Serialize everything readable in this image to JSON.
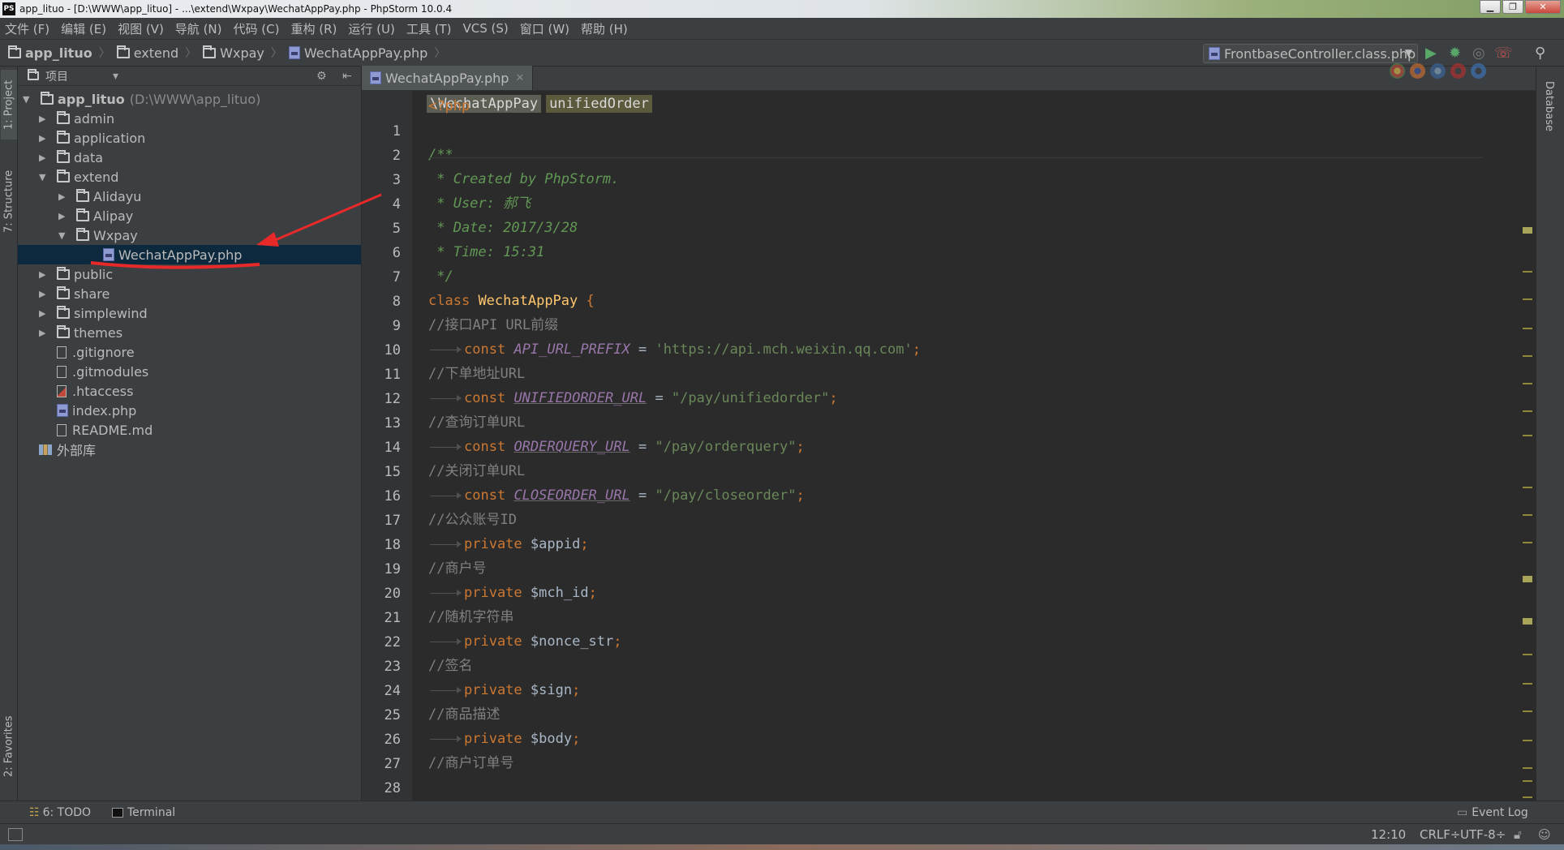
{
  "window": {
    "title": "app_lituo - [D:\\WWW\\app_lituo] - ...\\extend\\Wxpay\\WechatAppPay.php - PhpStorm 10.0.4",
    "logo": "PS"
  },
  "menu": [
    "文件 (F)",
    "编辑 (E)",
    "视图 (V)",
    "导航 (N)",
    "代码 (C)",
    "重构 (R)",
    "运行 (U)",
    "工具 (T)",
    "VCS (S)",
    "窗口 (W)",
    "帮助 (H)"
  ],
  "breadcrumbs": [
    "app_lituo",
    "extend",
    "Wxpay",
    "WechatAppPay.php"
  ],
  "run_config": "FrontbaseController.class.php",
  "left_tabs": {
    "project": "1: Project",
    "structure": "7: Structure",
    "favorites": "2: Favorites"
  },
  "right_tabs": {
    "database": "Database"
  },
  "project_panel": {
    "header": "项目",
    "root_name": "app_lituo",
    "root_path": "(D:\\WWW\\app_lituo)",
    "nodes": [
      "admin",
      "application",
      "data",
      "extend",
      "Alidayu",
      "Alipay",
      "Wxpay",
      "WechatAppPay.php",
      "public",
      "share",
      "simplewind",
      "themes",
      ".gitignore",
      ".gitmodules",
      ".htaccess",
      "index.php",
      "README.md",
      "外部库"
    ]
  },
  "editor": {
    "tab": "WechatAppPay.php",
    "crumb_class": "\\WechatAppPay",
    "crumb_method": "unifiedOrder",
    "line_numbers": [
      "1",
      "2",
      "3",
      "4",
      "5",
      "6",
      "7",
      "8",
      "9",
      "10",
      "11",
      "12",
      "13",
      "14",
      "15",
      "16",
      "17",
      "18",
      "19",
      "20",
      "21",
      "22",
      "23",
      "24",
      "25",
      "26",
      "27",
      "28"
    ],
    "code": {
      "php_open": "<?php",
      "doc_open": "/**",
      "doc_created": " * Created by PhpStorm.",
      "doc_user": " * User: 郝飞",
      "doc_date": " * Date: 2017/3/28",
      "doc_time": " * Time: 15:31",
      "doc_close": " */",
      "kw_class": "class",
      "class_name": "WechatAppPay",
      "brace": " {",
      "kw_const": "const",
      "kw_private": "private",
      "c10": "//接口API URL前缀",
      "const11": "API_URL_PREFIX",
      "val11": "'https://api.mch.weixin.qq.com'",
      "c12": "//下单地址URL",
      "const13": "UNIFIEDORDER_URL",
      "val13": "\"/pay/unifiedorder\"",
      "c14": "//查询订单URL",
      "const15": "ORDERQUERY_URL",
      "val15": "\"/pay/orderquery\"",
      "c16": "//关闭订单URL",
      "const17": "CLOSEORDER_URL",
      "val17": "\"/pay/closeorder\"",
      "c18": "//公众账号ID",
      "var19": "$appid",
      "c20": "//商户号",
      "var21": "$mch_id",
      "c22": "//随机字符串",
      "var23": "$nonce_str",
      "c24": "//签名",
      "var25": "$sign",
      "c26": "//商品描述",
      "var27": "$body",
      "c28": "//商户订单号",
      "eq": " = ",
      "semi": ";"
    }
  },
  "bottom_tools": {
    "todo": "6: TODO",
    "terminal": "Terminal",
    "event_log": "Event Log"
  },
  "status": {
    "position": "12:10",
    "line_sep": "CRLF÷",
    "encoding": "UTF-8÷"
  },
  "colors": {
    "selection": "#0d293e",
    "keyword": "#cc7832",
    "string": "#6a8759",
    "constant": "#9876aa",
    "class": "#ffc66d",
    "annotation": "#e8292a"
  }
}
